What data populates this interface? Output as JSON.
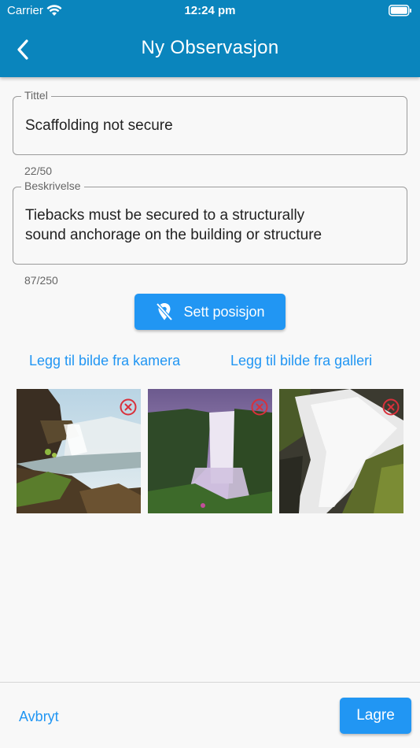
{
  "status_bar": {
    "carrier": "Carrier",
    "time": "12:24 pm"
  },
  "app_bar": {
    "title": "Ny Observasjon",
    "back_icon": "chevron-left-icon"
  },
  "title_field": {
    "label": "Tittel",
    "value": "Scaffolding not secure",
    "counter": "22/50"
  },
  "description_field": {
    "label": "Beskrivelse",
    "value_lines": [
      "Tiebacks must be secured to a structurally",
      "sound anchorage on the building or structure"
    ],
    "counter": "87/250"
  },
  "position_button": {
    "label": "Sett posisjon",
    "icon": "location-off-icon"
  },
  "image_actions": {
    "camera": "Legg til bilde fra kamera",
    "gallery": "Legg til bilde fra galleri"
  },
  "images": [
    {
      "name": "waterfall-photo-1",
      "delete_icon": "remove-circle-icon"
    },
    {
      "name": "waterfall-photo-2",
      "delete_icon": "remove-circle-icon"
    },
    {
      "name": "waterfall-photo-3",
      "delete_icon": "remove-circle-icon"
    }
  ],
  "bottom_bar": {
    "cancel": "Avbryt",
    "save": "Lagre"
  },
  "colors": {
    "app_bar": "#0a85bd",
    "accent": "#2196f3",
    "delete": "#d9303b"
  }
}
